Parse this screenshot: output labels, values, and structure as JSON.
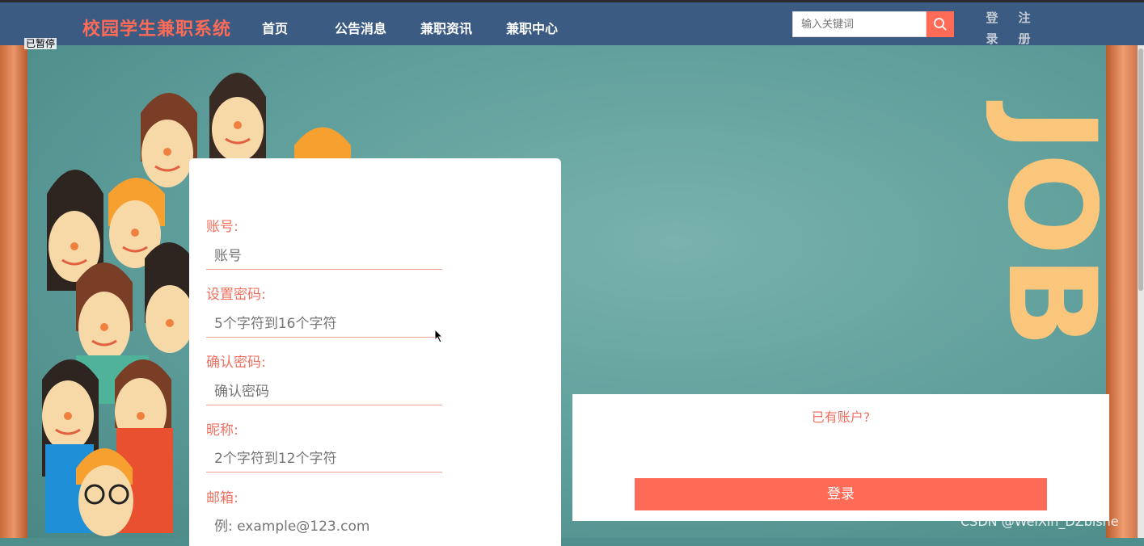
{
  "nav": {
    "brand": "校园学生兼职系统",
    "items": [
      "首页",
      "公告消息",
      "兼职资讯",
      "兼职中心"
    ],
    "search_placeholder": "输入关键词",
    "login": "登录",
    "register": "注册",
    "login_chars": [
      "登",
      "录"
    ],
    "register_chars": [
      "注",
      "册"
    ]
  },
  "overlay": {
    "paused": "已暂停"
  },
  "banner_letters": "JOB",
  "form": {
    "fields": [
      {
        "label": "账号:",
        "placeholder": "账号"
      },
      {
        "label": "设置密码:",
        "placeholder": "5个字符到16个字符"
      },
      {
        "label": "确认密码:",
        "placeholder": "确认密码"
      },
      {
        "label": "昵称:",
        "placeholder": "2个字符到12个字符"
      },
      {
        "label": "邮箱:",
        "placeholder": "例: example@123.com"
      }
    ]
  },
  "login_panel": {
    "question": "已有账户?",
    "button": "登录"
  },
  "watermark": "CSDN @WeiXin_DZbishe",
  "colors": {
    "nav_bg": "#3b5b82",
    "accent": "#ff6b57",
    "brand": "#ff6b57",
    "label": "#f07060"
  }
}
